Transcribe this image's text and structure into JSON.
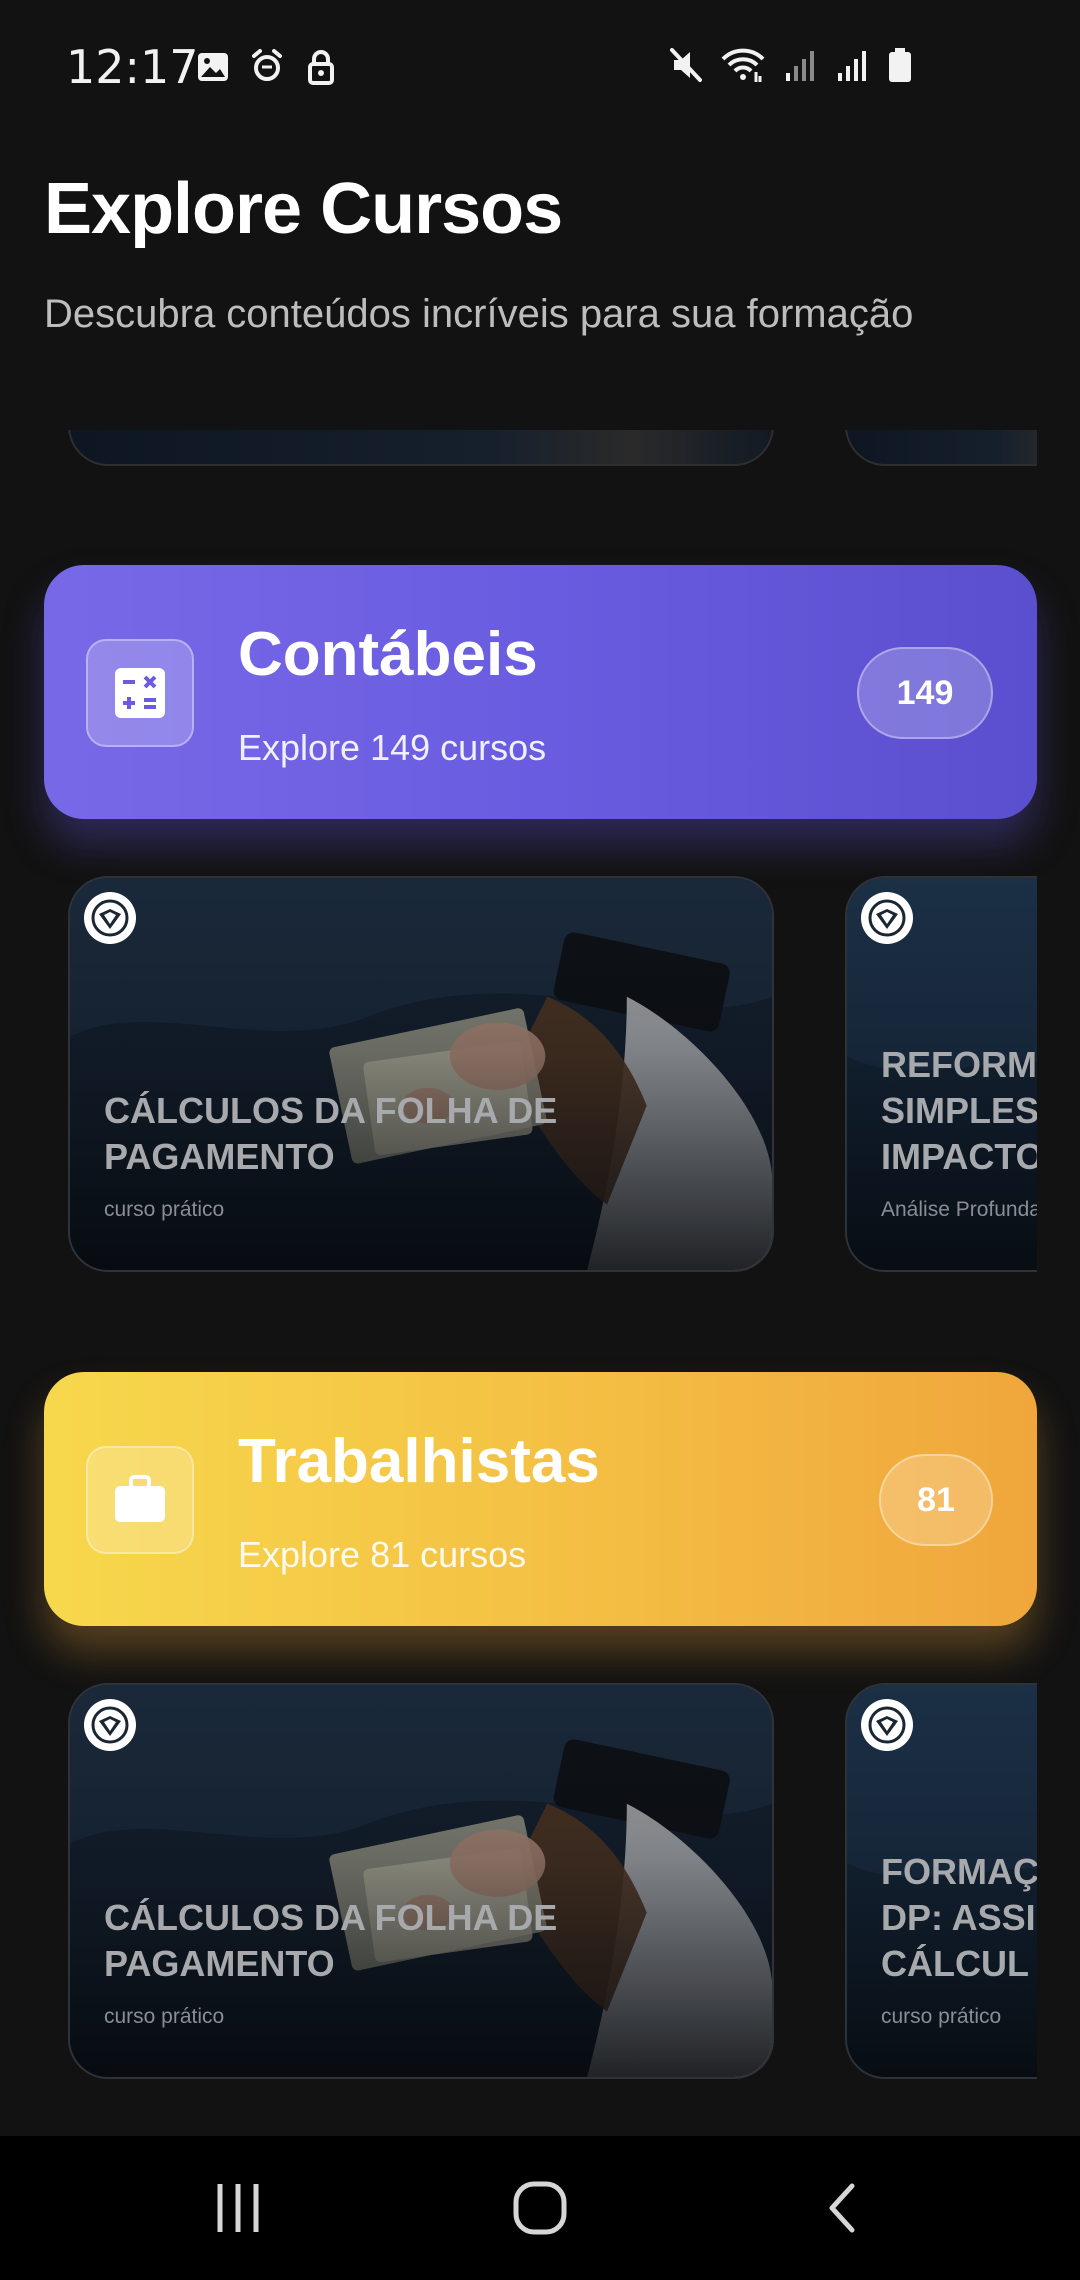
{
  "status_bar": {
    "time": "12:17",
    "left_icons": [
      "image-icon",
      "alarm-icon",
      "lock-icon"
    ],
    "right_icons": [
      "mute-icon",
      "wifi-icon",
      "signal-icon",
      "signal-icon",
      "battery-icon"
    ]
  },
  "header": {
    "title": "Explore Cursos",
    "subtitle": "Descubra conteúdos incríveis para sua formação"
  },
  "categories": [
    {
      "name": "Contábeis",
      "subtitle": "Explore 149 cursos",
      "count": "149",
      "icon": "calculator-icon",
      "color_start": "#7769e6",
      "color_end": "#5a4fce",
      "courses": [
        {
          "title_line1": "CÁLCULOS DA FOLHA DE",
          "title_line2": "PAGAMENTO",
          "title_line3": "",
          "tag": "curso prático"
        },
        {
          "title_line1": "REFORM",
          "title_line2": "SIMPLES",
          "title_line3": "IMPACTO",
          "tag": "Análise Profunda"
        }
      ]
    },
    {
      "name": "Trabalhistas",
      "subtitle": "Explore 81 cursos",
      "count": "81",
      "icon": "briefcase-icon",
      "color_start": "#f7d84c",
      "color_end": "#f0a63c",
      "courses": [
        {
          "title_line1": "CÁLCULOS DA FOLHA DE",
          "title_line2": "PAGAMENTO",
          "title_line3": "",
          "tag": "curso prático"
        },
        {
          "title_line1": "FORMAÇ",
          "title_line2": "DP: ASSI",
          "title_line3": "CÁLCUL",
          "tag": "curso prático"
        }
      ]
    }
  ],
  "nav_bar": {
    "buttons": [
      "recents-icon",
      "home-icon",
      "back-icon"
    ]
  }
}
